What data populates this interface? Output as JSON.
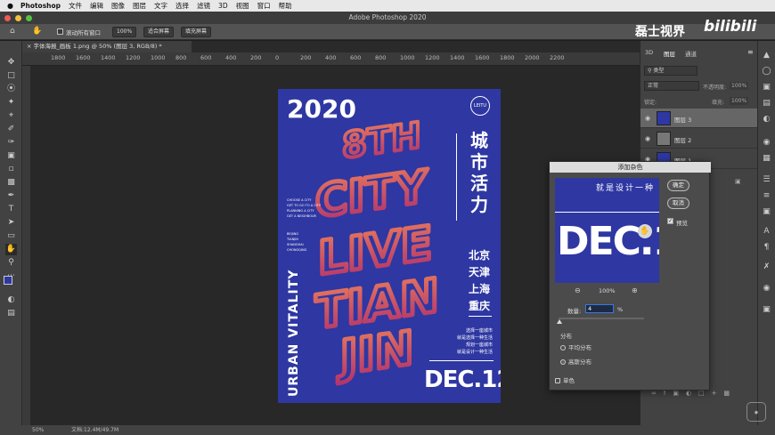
{
  "menubar": {
    "app": "Photoshop",
    "items": [
      "文件",
      "编辑",
      "图像",
      "图层",
      "文字",
      "选择",
      "滤镜",
      "3D",
      "视图",
      "窗口",
      "帮助"
    ]
  },
  "window": {
    "title": "Adobe Photoshop 2020"
  },
  "options": {
    "scroll_all": "滚动所有窗口",
    "zoom": "100%",
    "fit_screen": "适合屏幕",
    "fill_screen": "填充屏幕"
  },
  "watermark": {
    "text": "磊士视界",
    "logo": "bilibili"
  },
  "document": {
    "tab": "字体海报_画板 1.png @ 50% (图层 3, RGB/8) *"
  },
  "ruler": {
    "labels": [
      "1800",
      "1600",
      "1400",
      "1200",
      "1000",
      "800",
      "600",
      "400",
      "200",
      "0",
      "200",
      "400",
      "600",
      "800",
      "1000",
      "1200",
      "1400",
      "1600",
      "1800",
      "2000",
      "2200"
    ]
  },
  "poster": {
    "year": "2020",
    "badge": "LEITU",
    "title_cn": [
      "城",
      "市",
      "活",
      "力"
    ],
    "cities": [
      "北京",
      "天津",
      "上海",
      "重庆"
    ],
    "vertical_en": "URBAN VITALITY",
    "date": "DEC.12",
    "small_en_1": [
      "CHOOSE A CITY",
      "GET TO GO TO A CITY",
      "PLANNING A CITY",
      "GET A NEIGHBOUR"
    ],
    "small_en_2": [
      "BEIJING",
      "TIANJIN",
      "SHANGHAI",
      "CHONGQING"
    ],
    "lines_cn": [
      "选择一座城市",
      "就是选择一种生活",
      "规划一座城市",
      "就是设计一种生活"
    ],
    "art_text": [
      "8TH",
      "CITY",
      "LIVE",
      "TIAN",
      "JIN"
    ]
  },
  "layers_panel": {
    "tabs": [
      "3D",
      "图层",
      "通道"
    ],
    "filter": "类型",
    "blend_mode": "正常",
    "opacity_label": "不透明度:",
    "opacity": "100%",
    "lock_label": "锁定:",
    "fill_label": "填充:",
    "fill": "100%",
    "layers": [
      {
        "name": "图层 3",
        "selected": true
      },
      {
        "name": "图层 2",
        "selected": false
      },
      {
        "name": "图层 1",
        "selected": false
      }
    ]
  },
  "dialog": {
    "title": "添加杂色",
    "ok": "确定",
    "cancel": "取消",
    "preview": "预览",
    "preview_text_cn": "就是设计一种",
    "preview_date": "DEC.1",
    "zoom": "100%",
    "amount_label": "数量:",
    "amount": "4",
    "amount_unit": "%",
    "distribution": "分布",
    "uniform": "平均分布",
    "gaussian": "高斯分布",
    "monochrome": "单色"
  },
  "status": {
    "zoom": "50%",
    "doc": "文档:12.4M/49.7M"
  },
  "colors": {
    "poster_blue": "#2e37a2",
    "poster_red": "#e8674e",
    "accent": "#3a78e0"
  }
}
